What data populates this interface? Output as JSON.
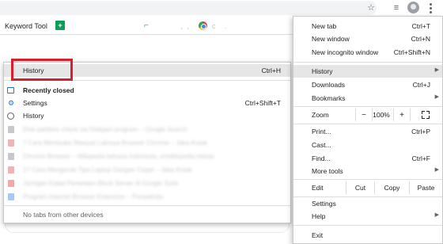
{
  "toolbar": {
    "icons": [
      "star-icon",
      "media-queue-icon",
      "avatar",
      "kebab-menu-icon"
    ]
  },
  "bookmarks": {
    "keyword_tool": "Keyword Tool",
    "sheets_glyph": "+",
    "green_glyph": "⌐",
    "dots1": ",",
    "dots2": ",",
    "c_label": "c",
    "dots3": "."
  },
  "history_submenu": {
    "history_label": "History",
    "history_shortcut": "Ctrl+H",
    "recently_closed": "Recently closed",
    "settings_label": "Settings",
    "settings_shortcut": "Ctrl+Shift+T",
    "history2_label": "History",
    "blurred_items": [
      {
        "text": "Disk partition check via Diskpart program – Google Search",
        "color": "#c5c8cc"
      },
      {
        "text": "7 Cara Membuka Riwayat Lainnya Browser Chrome – Jaka Kotak",
        "color": "#f0b4b4"
      },
      {
        "text": "Chrome Browser – Wikipedia bahasa Indonesia, ensiklopedia bebas",
        "color": "#c5c8cc"
      },
      {
        "text": "17 Cara Mengecek Tipe Laptop Dengan Cepat – Jaka Kotak",
        "color": "#f0b4b4"
      },
      {
        "text": "Jaringan Kabel Pemetaan Block Server di Google Suite",
        "color": "#f5a6a6"
      },
      {
        "text": "Program Internet Browser Extension – Ponselindo",
        "color": "#a8c7fa"
      }
    ],
    "no_tabs": "No tabs from other devices"
  },
  "chrome_menu": {
    "new_tab": "New tab",
    "new_tab_shortcut": "Ctrl+T",
    "new_window": "New window",
    "new_window_shortcut": "Ctrl+N",
    "new_incognito": "New incognito window",
    "new_incognito_shortcut": "Ctrl+Shift+N",
    "history": "History",
    "downloads": "Downloads",
    "downloads_shortcut": "Ctrl+J",
    "bookmarks": "Bookmarks",
    "zoom_label": "Zoom",
    "zoom_minus": "−",
    "zoom_value": "100%",
    "zoom_plus": "+",
    "print": "Print...",
    "print_shortcut": "Ctrl+P",
    "cast": "Cast...",
    "find": "Find...",
    "find_shortcut": "Ctrl+F",
    "more_tools": "More tools",
    "edit_label": "Edit",
    "cut": "Cut",
    "copy": "Copy",
    "paste": "Paste",
    "settings": "Settings",
    "help": "Help",
    "exit": "Exit",
    "submenu_arrow": "▶"
  },
  "highlight_color": "#d6202d"
}
